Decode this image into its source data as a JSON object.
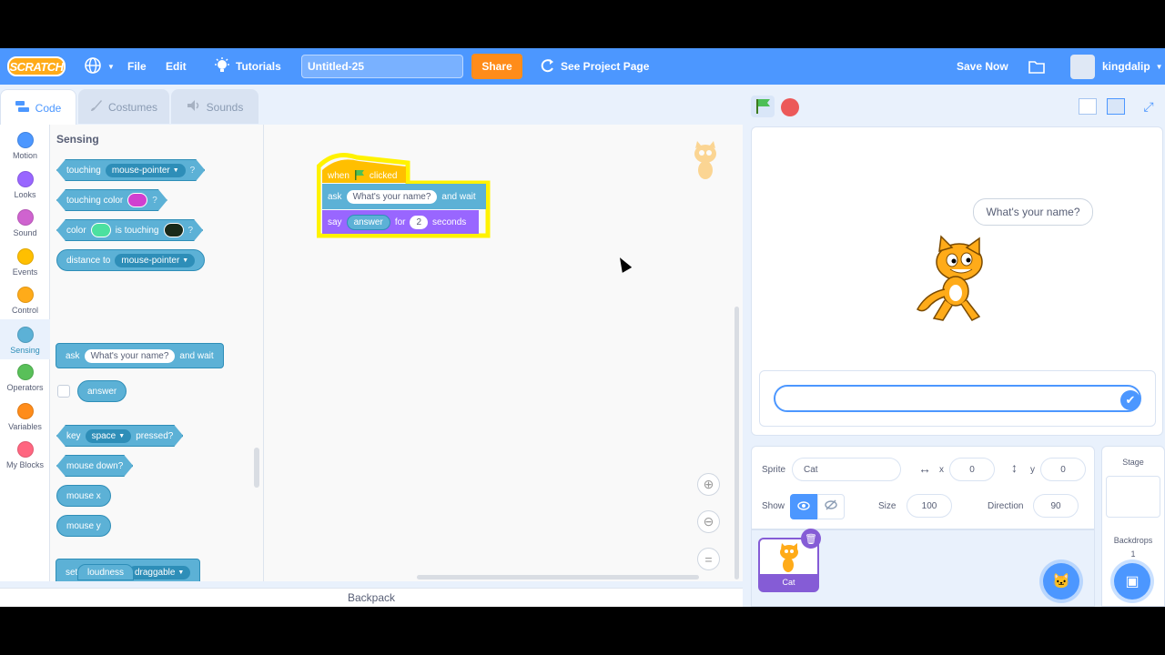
{
  "menu": {
    "logo": "SCRATCH",
    "file": "File",
    "edit": "Edit",
    "tutorials": "Tutorials",
    "project_title": "Untitled-25",
    "share": "Share",
    "see_project_page": "See Project Page",
    "save_now": "Save Now",
    "username": "kingdalip"
  },
  "tabs": {
    "code": "Code",
    "costumes": "Costumes",
    "sounds": "Sounds"
  },
  "categories": [
    {
      "label": "Motion",
      "color": "#4c97ff"
    },
    {
      "label": "Looks",
      "color": "#9966ff"
    },
    {
      "label": "Sound",
      "color": "#cf63cf"
    },
    {
      "label": "Events",
      "color": "#ffbf00"
    },
    {
      "label": "Control",
      "color": "#ffab19"
    },
    {
      "label": "Sensing",
      "color": "#5cb1d6"
    },
    {
      "label": "Operators",
      "color": "#59c059"
    },
    {
      "label": "Variables",
      "color": "#ff8c1a"
    },
    {
      "label": "My Blocks",
      "color": "#ff6680"
    }
  ],
  "palette": {
    "title": "Sensing",
    "touching": "touching",
    "touching_target": "mouse-pointer",
    "q": "?",
    "touching_color": "touching color",
    "color": "color",
    "is_touching": "is touching",
    "distance_to": "distance to",
    "distance_target": "mouse-pointer",
    "ask": "ask",
    "ask_text": "What's your name?",
    "and_wait": "and wait",
    "answer": "answer",
    "key": "key",
    "key_value": "space",
    "pressed": "pressed?",
    "mouse_down": "mouse down?",
    "mouse_x": "mouse x",
    "mouse_y": "mouse y",
    "set_drag_mode": "set drag mode",
    "drag_value": "draggable",
    "loudness": "loudness",
    "colors": {
      "pink": "#d040d0",
      "green": "#4ce0a0",
      "dark": "#1a2a1a"
    }
  },
  "script": {
    "when": "when",
    "clicked": "clicked",
    "ask": "ask",
    "ask_text": "What's your name?",
    "and_wait": "and wait",
    "say": "say",
    "answer": "answer",
    "for": "for",
    "seconds_value": "2",
    "seconds": "seconds"
  },
  "backpack": "Backpack",
  "stage": {
    "bubble": "What's your name?"
  },
  "sprite_info": {
    "sprite_label": "Sprite",
    "sprite_name": "Cat",
    "x_label": "x",
    "x_value": "0",
    "y_label": "y",
    "y_value": "0",
    "show_label": "Show",
    "size_label": "Size",
    "size_value": "100",
    "direction_label": "Direction",
    "direction_value": "90"
  },
  "sprite_list": [
    {
      "name": "Cat"
    }
  ],
  "stage_panel": {
    "title": "Stage",
    "backdrops": "Backdrops",
    "backdrop_count": "1"
  }
}
